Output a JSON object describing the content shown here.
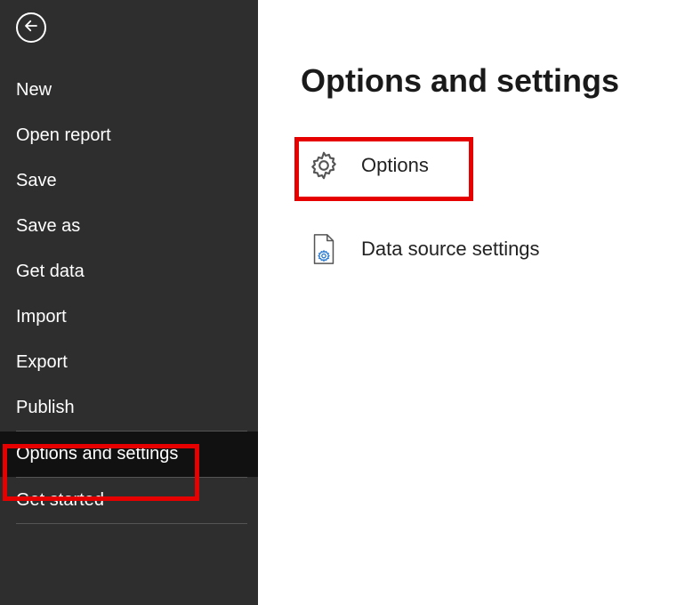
{
  "sidebar": {
    "items": [
      {
        "label": "New"
      },
      {
        "label": "Open report"
      },
      {
        "label": "Save"
      },
      {
        "label": "Save as"
      },
      {
        "label": "Get data"
      },
      {
        "label": "Import"
      },
      {
        "label": "Export"
      },
      {
        "label": "Publish"
      },
      {
        "label": "Options and settings",
        "selected": true
      },
      {
        "label": "Get started"
      }
    ]
  },
  "main": {
    "title": "Options and settings",
    "options": [
      {
        "label": "Options",
        "icon": "gear",
        "highlighted": true
      },
      {
        "label": "Data source settings",
        "icon": "doc-gear",
        "highlighted": false
      }
    ]
  }
}
